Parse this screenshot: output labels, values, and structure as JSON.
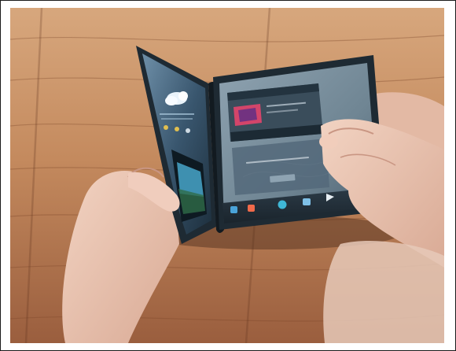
{
  "photo": {
    "subject": "foldable-tablet-demo",
    "colors": {
      "table_light": "#c79066",
      "table_dark": "#8a5235",
      "device_frame": "#1e2a33",
      "screen_left": "#3b5a72",
      "screen_right": "#7a8f9c",
      "accent_cyan": "#49b8d8",
      "skin": "#e8c2ae"
    }
  },
  "screen": {
    "header_text": "",
    "dialog_title": "",
    "dialog_body": "",
    "dialog_button": "",
    "icons": [
      "weather-icon",
      "clock-icon",
      "phone-icon",
      "messages-icon",
      "globe-icon",
      "gallery-icon",
      "play-store-icon"
    ]
  }
}
